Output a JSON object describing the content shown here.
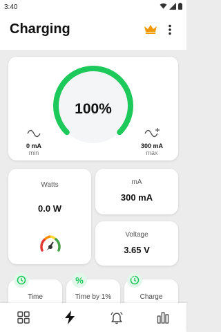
{
  "status_bar": {
    "time": "3:40"
  },
  "app_bar": {
    "title": "Charging"
  },
  "gauge": {
    "percent_label": "100%",
    "percent_value": 100,
    "min_value": "0 mA",
    "min_caption": "min",
    "max_value": "300 mA",
    "max_caption": "max"
  },
  "watts": {
    "label": "Watts",
    "value": "0.0 W"
  },
  "current": {
    "label": "mA",
    "value": "300 mA"
  },
  "voltage": {
    "label": "Voltage",
    "value": "3.65 V"
  },
  "info_cards": [
    {
      "label": "Time",
      "icon": "clock-icon"
    },
    {
      "label": "Time by 1%",
      "icon": "percent-icon",
      "badge_text": "%"
    },
    {
      "label": "Charge",
      "icon": "charge-timer-icon"
    }
  ],
  "bottom_nav": [
    {
      "name": "dashboard",
      "icon": "grid-icon"
    },
    {
      "name": "charging",
      "icon": "lightning-icon",
      "active": true
    },
    {
      "name": "alarm",
      "icon": "bell-icon"
    },
    {
      "name": "statistics",
      "icon": "bar-chart-icon"
    }
  ],
  "colors": {
    "accent_green": "#1ec95b",
    "crown_orange": "#f29900",
    "background": "#ececec"
  }
}
